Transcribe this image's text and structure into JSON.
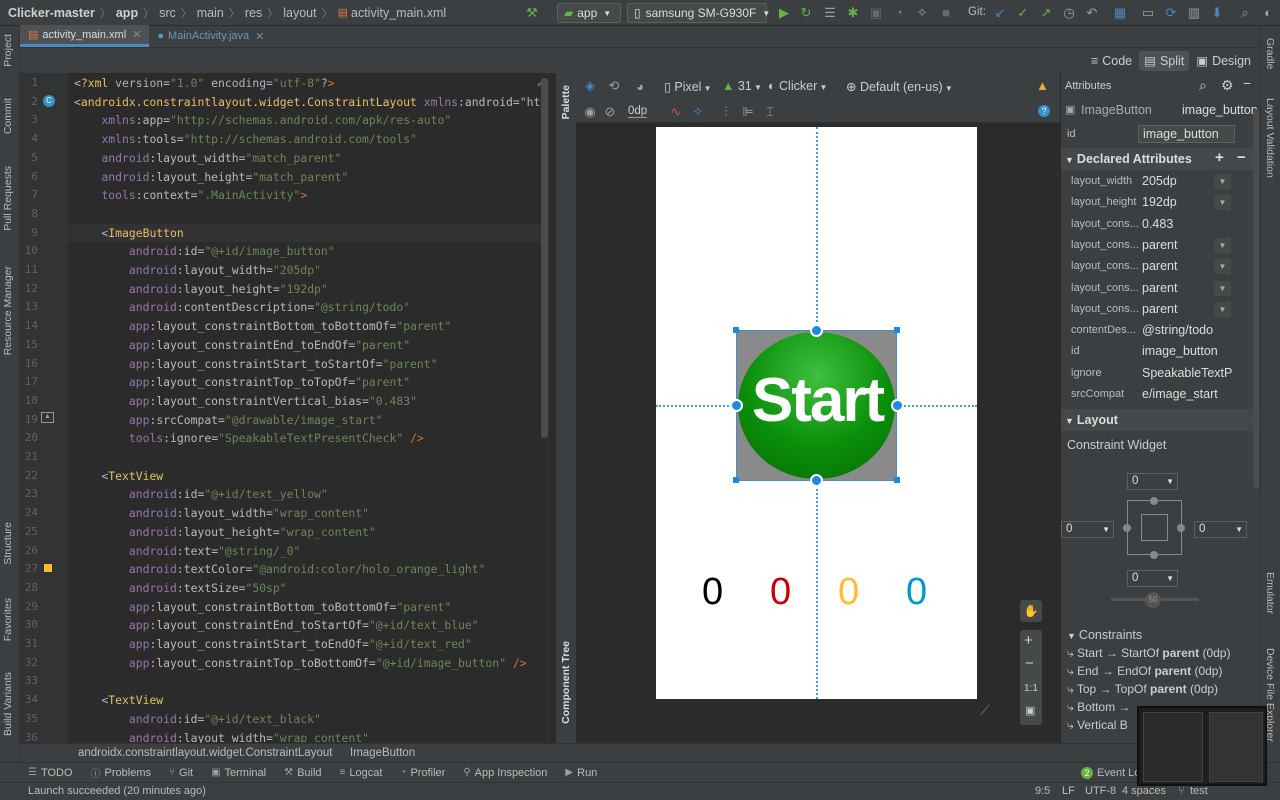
{
  "breadcrumbs": [
    "Clicker-master",
    "app",
    "src",
    "main",
    "res",
    "layout",
    "activity_main.xml"
  ],
  "run_config": "app",
  "device": "samsung SM-G930F",
  "git_label": "Git:",
  "file_tabs": [
    {
      "label": "activity_main.xml",
      "active": true
    },
    {
      "label": "MainActivity.java",
      "active": false
    }
  ],
  "view_modes": {
    "code": "Code",
    "split": "Split",
    "design": "Design"
  },
  "left_tools": [
    "Project",
    "Commit",
    "Pull Requests",
    "Resource Manager",
    "Structure",
    "Favorites",
    "Build Variants"
  ],
  "right_tools": [
    "Gradle",
    "Layout Validation",
    "Emulator",
    "Device File Explorer"
  ],
  "palette_tabs": [
    "Palette",
    "Component Tree"
  ],
  "code_lines": [
    {
      "n": "1",
      "text": "<?xml version=\"1.0\" encoding=\"utf-8\"?>"
    },
    {
      "n": "2",
      "text": "<androidx.constraintlayout.widget.ConstraintLayout xmlns:android=\"ht"
    },
    {
      "n": "3",
      "text": "    xmlns:app=\"http://schemas.android.com/apk/res-auto\""
    },
    {
      "n": "4",
      "text": "    xmlns:tools=\"http://schemas.android.com/tools\""
    },
    {
      "n": "5",
      "text": "    android:layout_width=\"match_parent\""
    },
    {
      "n": "6",
      "text": "    android:layout_height=\"match_parent\""
    },
    {
      "n": "7",
      "text": "    tools:context=\".MainActivity\">"
    },
    {
      "n": "8",
      "text": ""
    },
    {
      "n": "9",
      "text": "    <ImageButton"
    },
    {
      "n": "10",
      "text": "        android:id=\"@+id/image_button\""
    },
    {
      "n": "11",
      "text": "        android:layout_width=\"205dp\""
    },
    {
      "n": "12",
      "text": "        android:layout_height=\"192dp\""
    },
    {
      "n": "13",
      "text": "        android:contentDescription=\"@string/todo\""
    },
    {
      "n": "14",
      "text": "        app:layout_constraintBottom_toBottomOf=\"parent\""
    },
    {
      "n": "15",
      "text": "        app:layout_constraintEnd_toEndOf=\"parent\""
    },
    {
      "n": "16",
      "text": "        app:layout_constraintStart_toStartOf=\"parent\""
    },
    {
      "n": "17",
      "text": "        app:layout_constraintTop_toTopOf=\"parent\""
    },
    {
      "n": "18",
      "text": "        app:layout_constraintVertical_bias=\"0.483\""
    },
    {
      "n": "19",
      "text": "        app:srcCompat=\"@drawable/image_start\""
    },
    {
      "n": "20",
      "text": "        tools:ignore=\"SpeakableTextPresentCheck\" />"
    },
    {
      "n": "21",
      "text": ""
    },
    {
      "n": "22",
      "text": "    <TextView"
    },
    {
      "n": "23",
      "text": "        android:id=\"@+id/text_yellow\""
    },
    {
      "n": "24",
      "text": "        android:layout_width=\"wrap_content\""
    },
    {
      "n": "25",
      "text": "        android:layout_height=\"wrap_content\""
    },
    {
      "n": "26",
      "text": "        android:text=\"@string/_0\""
    },
    {
      "n": "27",
      "text": "        android:textColor=\"@android:color/holo_orange_light\""
    },
    {
      "n": "28",
      "text": "        android:textSize=\"50sp\""
    },
    {
      "n": "29",
      "text": "        app:layout_constraintBottom_toBottomOf=\"parent\""
    },
    {
      "n": "30",
      "text": "        app:layout_constraintEnd_toStartOf=\"@+id/text_blue\""
    },
    {
      "n": "31",
      "text": "        app:layout_constraintStart_toEndOf=\"@+id/text_red\""
    },
    {
      "n": "32",
      "text": "        app:layout_constraintTop_toBottomOf=\"@+id/image_button\" />"
    },
    {
      "n": "33",
      "text": ""
    },
    {
      "n": "34",
      "text": "    <TextView"
    },
    {
      "n": "35",
      "text": "        android:id=\"@+id/text_black\""
    },
    {
      "n": "36",
      "text": "        android:layout_width=\"wrap_content\""
    }
  ],
  "design_toolbar": {
    "device": "Pixel",
    "api": "31",
    "theme": "Clicker",
    "locale": "Default (en-us)",
    "margin": "0dp"
  },
  "preview": {
    "button_text": "Start",
    "counters": [
      {
        "value": "0",
        "color": "#000000"
      },
      {
        "value": "0",
        "color": "#cc0000"
      },
      {
        "value": "0",
        "color": "#ffbb33"
      },
      {
        "value": "0",
        "color": "#0099cc"
      }
    ]
  },
  "zoom_fit": "1:1",
  "attributes": {
    "title": "Attributes",
    "widget_type": "ImageButton",
    "widget_id": "image_button",
    "id_label": "id",
    "id_value": "image_button",
    "declared_title": "Declared Attributes",
    "declared": [
      {
        "key": "layout_width",
        "value": "205dp",
        "dropdown": true
      },
      {
        "key": "layout_height",
        "value": "192dp",
        "dropdown": true
      },
      {
        "key": "layout_cons...",
        "value": "0.483",
        "dropdown": false
      },
      {
        "key": "layout_cons...",
        "value": "parent",
        "dropdown": true
      },
      {
        "key": "layout_cons...",
        "value": "parent",
        "dropdown": true
      },
      {
        "key": "layout_cons...",
        "value": "parent",
        "dropdown": true
      },
      {
        "key": "layout_cons...",
        "value": "parent",
        "dropdown": true
      },
      {
        "key": "contentDes...",
        "value": "@string/todo",
        "dropdown": false
      },
      {
        "key": "id",
        "value": "image_button",
        "dropdown": false
      },
      {
        "key": "ignore",
        "value": "SpeakableTextP",
        "dropdown": false
      },
      {
        "key": "srcCompat",
        "value": "e/image_start",
        "dropdown": false
      }
    ],
    "layout_title": "Layout",
    "layout_type": "Constraint Widget",
    "margins": {
      "top": "0",
      "left": "0",
      "right": "0",
      "bottom": "0"
    },
    "bias": "50",
    "constraints_title": "Constraints",
    "constraints": [
      {
        "a": "Start → StartOf ",
        "b": "parent",
        "c": " (0dp)"
      },
      {
        "a": "End → EndOf ",
        "b": "parent",
        "c": " (0dp)"
      },
      {
        "a": "Top → TopOf ",
        "b": "parent",
        "c": " (0dp)"
      },
      {
        "a": "Bottom →",
        "b": "",
        "c": ""
      },
      {
        "a": "Vertical B",
        "b": "",
        "c": ""
      }
    ]
  },
  "editor_breadcrumb": [
    "androidx.constraintlayout.widget.ConstraintLayout",
    "ImageButton"
  ],
  "bottom_tabs": [
    "TODO",
    "Problems",
    "Git",
    "Terminal",
    "Build",
    "Logcat",
    "Profiler",
    "App Inspection",
    "Run"
  ],
  "event_log": {
    "count": "2",
    "label": "Event Lo"
  },
  "status": {
    "message": "Launch succeeded (20 minutes ago)",
    "position": "9:5",
    "line_sep": "LF",
    "encoding": "UTF-8",
    "indent": "4 spaces",
    "branch": "test"
  }
}
